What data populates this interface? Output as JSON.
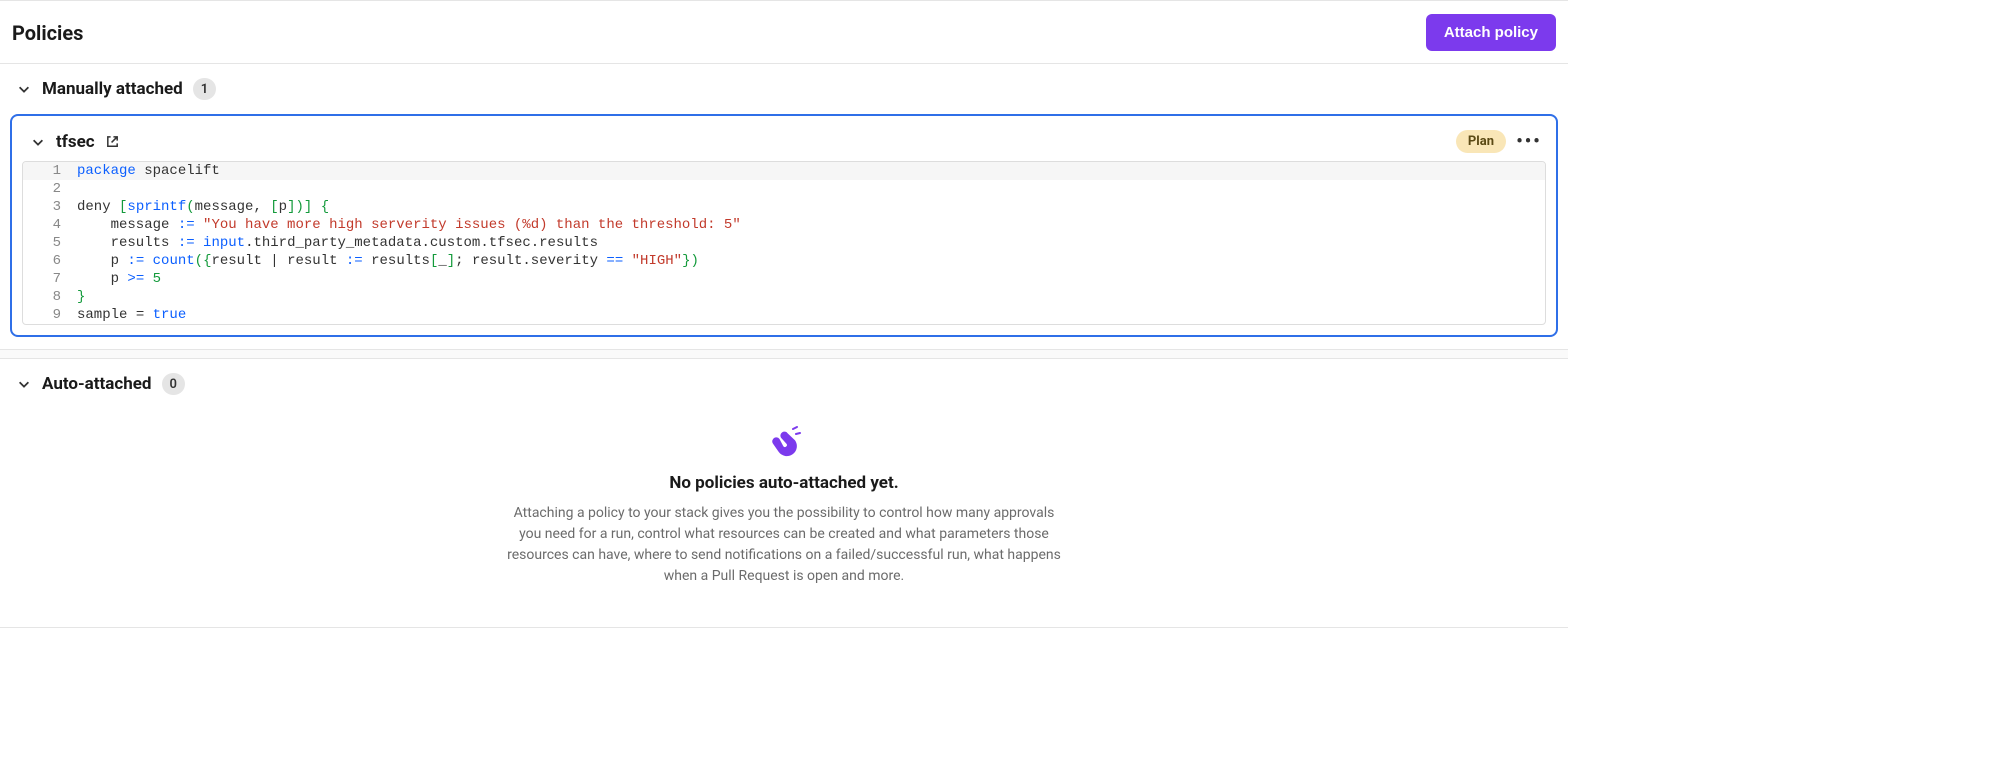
{
  "header": {
    "title": "Policies",
    "attach_button_label": "Attach policy"
  },
  "sections": {
    "manual": {
      "title": "Manually attached",
      "count": "1"
    },
    "auto": {
      "title": "Auto-attached",
      "count": "0"
    }
  },
  "policy_card": {
    "name": "tfsec",
    "badge": "Plan",
    "code_lines": [
      {
        "n": "1",
        "tokens": [
          {
            "t": "package",
            "c": "kw"
          },
          {
            "t": " ",
            "c": "sp"
          },
          {
            "t": "spacelift",
            "c": "id"
          }
        ]
      },
      {
        "n": "2",
        "tokens": []
      },
      {
        "n": "3",
        "tokens": [
          {
            "t": "deny ",
            "c": "id"
          },
          {
            "t": "[",
            "c": "br"
          },
          {
            "t": "sprintf",
            "c": "kw"
          },
          {
            "t": "(",
            "c": "br"
          },
          {
            "t": "message",
            "c": "id"
          },
          {
            "t": ", ",
            "c": "op"
          },
          {
            "t": "[",
            "c": "br"
          },
          {
            "t": "p",
            "c": "id"
          },
          {
            "t": "]",
            "c": "br"
          },
          {
            "t": ")",
            "c": "br"
          },
          {
            "t": "]",
            "c": "br"
          },
          {
            "t": " ",
            "c": "sp"
          },
          {
            "t": "{",
            "c": "br"
          }
        ]
      },
      {
        "n": "4",
        "tokens": [
          {
            "t": "    message ",
            "c": "id"
          },
          {
            "t": ":= ",
            "c": "kw"
          },
          {
            "t": "\"You have more high serverity issues (%d) than the threshold: 5\"",
            "c": "str"
          }
        ]
      },
      {
        "n": "5",
        "tokens": [
          {
            "t": "    results ",
            "c": "id"
          },
          {
            "t": ":= ",
            "c": "kw"
          },
          {
            "t": "input",
            "c": "kw"
          },
          {
            "t": ".",
            "c": "op"
          },
          {
            "t": "third_party_metadata",
            "c": "id"
          },
          {
            "t": ".",
            "c": "op"
          },
          {
            "t": "custom",
            "c": "id"
          },
          {
            "t": ".",
            "c": "op"
          },
          {
            "t": "tfsec",
            "c": "id"
          },
          {
            "t": ".",
            "c": "op"
          },
          {
            "t": "results",
            "c": "id"
          }
        ]
      },
      {
        "n": "6",
        "tokens": [
          {
            "t": "    p ",
            "c": "id"
          },
          {
            "t": ":= ",
            "c": "kw"
          },
          {
            "t": "count",
            "c": "kw"
          },
          {
            "t": "(",
            "c": "br"
          },
          {
            "t": "{",
            "c": "br"
          },
          {
            "t": "result ",
            "c": "id"
          },
          {
            "t": "| ",
            "c": "op"
          },
          {
            "t": "result ",
            "c": "id"
          },
          {
            "t": ":= ",
            "c": "kw"
          },
          {
            "t": "results",
            "c": "id"
          },
          {
            "t": "[",
            "c": "br"
          },
          {
            "t": "_",
            "c": "id"
          },
          {
            "t": "]",
            "c": "br"
          },
          {
            "t": "; ",
            "c": "op"
          },
          {
            "t": "result",
            "c": "id"
          },
          {
            "t": ".",
            "c": "op"
          },
          {
            "t": "severity ",
            "c": "id"
          },
          {
            "t": "== ",
            "c": "kw"
          },
          {
            "t": "\"HIGH\"",
            "c": "str"
          },
          {
            "t": "}",
            "c": "br"
          },
          {
            "t": ")",
            "c": "br"
          }
        ]
      },
      {
        "n": "7",
        "tokens": [
          {
            "t": "    p ",
            "c": "id"
          },
          {
            "t": ">= ",
            "c": "kw"
          },
          {
            "t": "5",
            "c": "num"
          }
        ]
      },
      {
        "n": "8",
        "tokens": [
          {
            "t": "}",
            "c": "br"
          }
        ]
      },
      {
        "n": "9",
        "tokens": [
          {
            "t": "sample ",
            "c": "id"
          },
          {
            "t": "= ",
            "c": "op"
          },
          {
            "t": "true",
            "c": "kw"
          }
        ]
      }
    ]
  },
  "empty_state": {
    "title": "No policies auto-attached yet.",
    "description": "Attaching a policy to your stack gives you the possibility to control how many approvals you need for a run, control what resources can be created and what parameters those resources can have, where to send notifications on a failed/successful run, what happens when a Pull Request is open and more."
  }
}
